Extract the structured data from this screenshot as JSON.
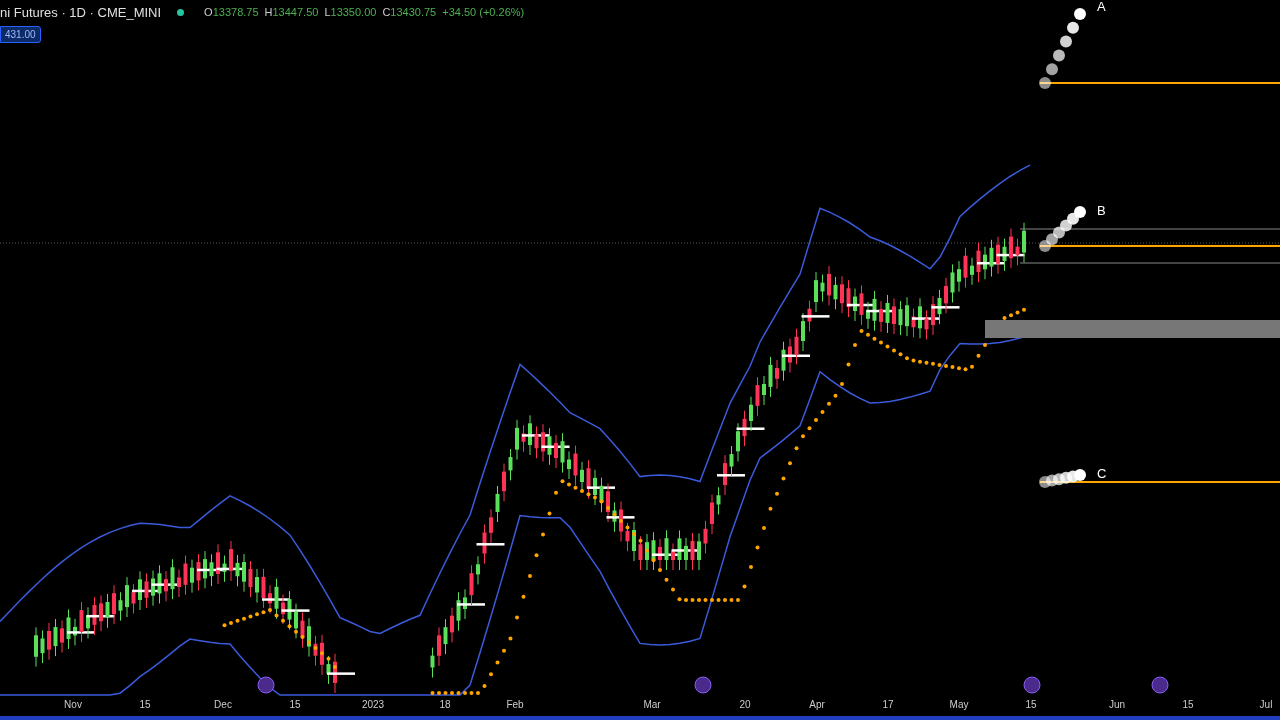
{
  "header": {
    "title": "ni Futures · 1D · CME_MINI",
    "ohlc": [
      {
        "key": "O",
        "value": "13378.75"
      },
      {
        "key": "H",
        "value": "13447.50"
      },
      {
        "key": "L",
        "value": "13350.00"
      },
      {
        "key": "C",
        "value": "13430.75"
      }
    ],
    "change": "+34.50 (+0.26%)"
  },
  "price_badge": "431.00",
  "chart": {
    "markers": [
      {
        "label": "A"
      },
      {
        "label": "B"
      },
      {
        "label": "C"
      }
    ]
  },
  "time_axis": [
    "Nov",
    "15",
    "Dec",
    "15",
    "2023",
    "18",
    "Feb",
    "Mar",
    "20",
    "Apr",
    "17",
    "May",
    "15",
    "Jun",
    "15",
    "Jul"
  ]
}
